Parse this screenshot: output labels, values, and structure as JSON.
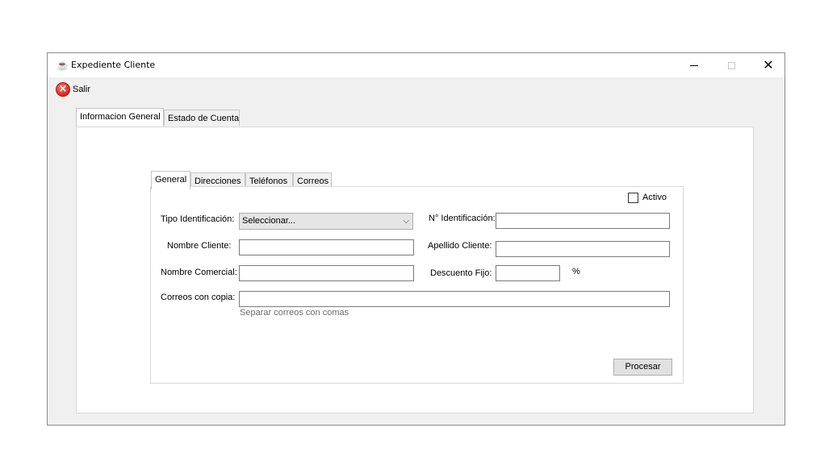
{
  "window": {
    "title": "Expediente Cliente",
    "controls": {
      "minimize": "–",
      "maximize": "□",
      "close": "✕"
    }
  },
  "toolbar": {
    "salir_label": "Salir",
    "salir_icon": "close-circle-icon"
  },
  "outer_tabs": [
    {
      "label": "Informacion General",
      "active": true
    },
    {
      "label": "Estado de Cuenta",
      "active": false
    }
  ],
  "inner_tabs": [
    {
      "label": "General",
      "active": true
    },
    {
      "label": "Direcciones",
      "active": false
    },
    {
      "label": "Teléfonos",
      "active": false
    },
    {
      "label": "Correos",
      "active": false
    }
  ],
  "form": {
    "activo_label": "Activo",
    "activo_checked": false,
    "tipo_identificacion_label": "Tipo Identificación:",
    "tipo_identificacion_value": "Seleccionar...",
    "n_identificacion_label": "N° Identificación:",
    "n_identificacion_value": "",
    "nombre_cliente_label": "Nombre Cliente:",
    "nombre_cliente_value": "",
    "apellido_cliente_label": "Apellido Cliente:",
    "apellido_cliente_value": "",
    "nombre_comercial_label": "Nombre Comercial:",
    "nombre_comercial_value": "",
    "descuento_fijo_label": "Descuento Fijo:",
    "descuento_fijo_value": "",
    "percent_symbol": "%",
    "correos_copia_label": "Correos con copia:",
    "correos_copia_value": "",
    "correos_hint": "Separar correos con comas",
    "procesar_label": "Procesar"
  }
}
